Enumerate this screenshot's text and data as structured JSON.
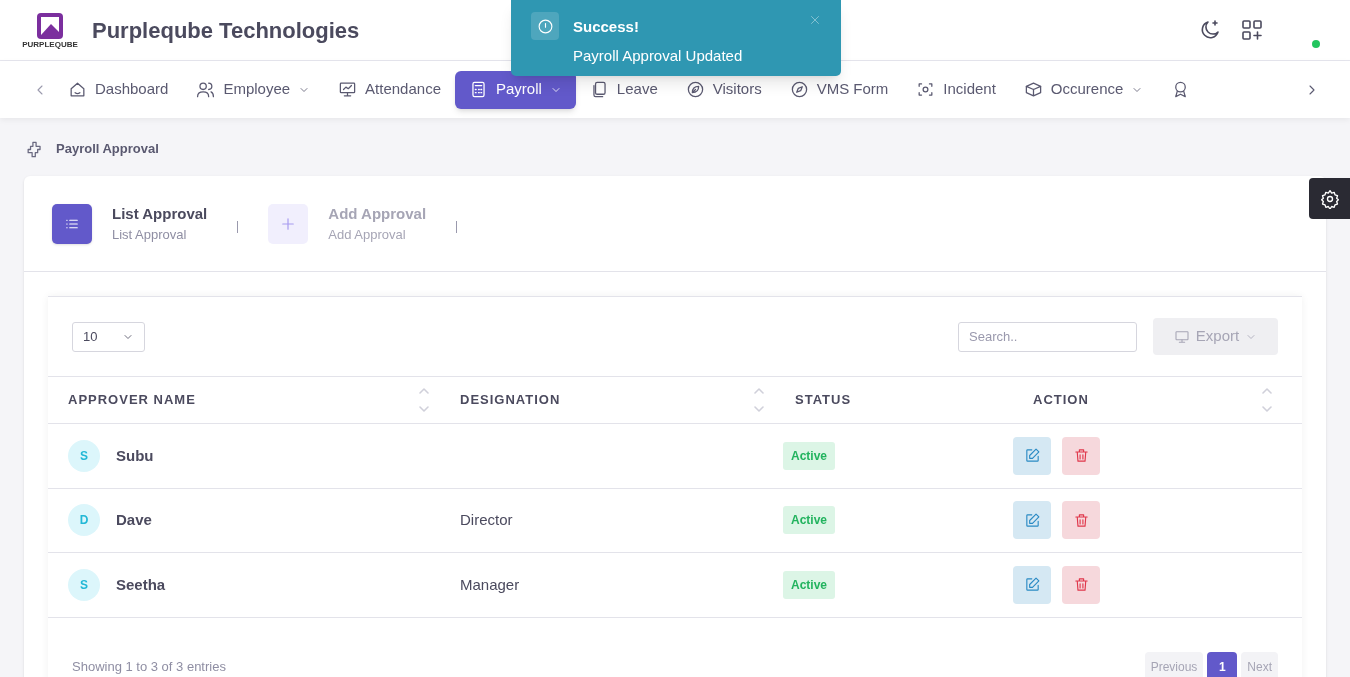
{
  "header": {
    "logo_text": "PURPLEQUBE",
    "company": "Purpleqube Technologies"
  },
  "nav": [
    {
      "label": "Dashboard",
      "dropdown": false,
      "selected": false
    },
    {
      "label": "Employee",
      "dropdown": true,
      "selected": false
    },
    {
      "label": "Attendance",
      "dropdown": false,
      "selected": false
    },
    {
      "label": "Payroll",
      "dropdown": true,
      "selected": true
    },
    {
      "label": "Leave",
      "dropdown": false,
      "selected": false
    },
    {
      "label": "Visitors",
      "dropdown": false,
      "selected": false
    },
    {
      "label": "VMS Form",
      "dropdown": false,
      "selected": false
    },
    {
      "label": "Incident",
      "dropdown": false,
      "selected": false
    },
    {
      "label": "Occurence",
      "dropdown": true,
      "selected": false
    },
    {
      "dropdown": false,
      "selected": false
    }
  ],
  "toast": {
    "title": "Success!",
    "message": "Payroll Approval Updated"
  },
  "breadcrumb": "Payroll Approval",
  "tabs": [
    {
      "title": "List Approval",
      "subtitle": "List Approval",
      "selected": true
    },
    {
      "title": "Add Approval",
      "subtitle": "Add Approval",
      "selected": false
    }
  ],
  "table": {
    "page_size": "10",
    "search": {
      "placeholder": "Search.."
    },
    "export": "Export",
    "columns": [
      "APPROVER NAME",
      "DESIGNATION",
      "STATUS",
      "ACTION"
    ],
    "rows": [
      {
        "initial": "S",
        "name": "Subu",
        "status": "Active"
      },
      {
        "initial": "D",
        "name": "Dave",
        "designation": "Director",
        "status": "Active"
      },
      {
        "initial": "S",
        "name": "Seetha",
        "designation": "Manager",
        "status": "Active"
      }
    ]
  },
  "footer": {
    "info": "Showing 1 to 3 of 3 entries",
    "pages": [
      {
        "label": "Previous",
        "selected": false
      },
      {
        "label": "1",
        "selected": true
      },
      {
        "label": "Next",
        "selected": false
      }
    ]
  }
}
